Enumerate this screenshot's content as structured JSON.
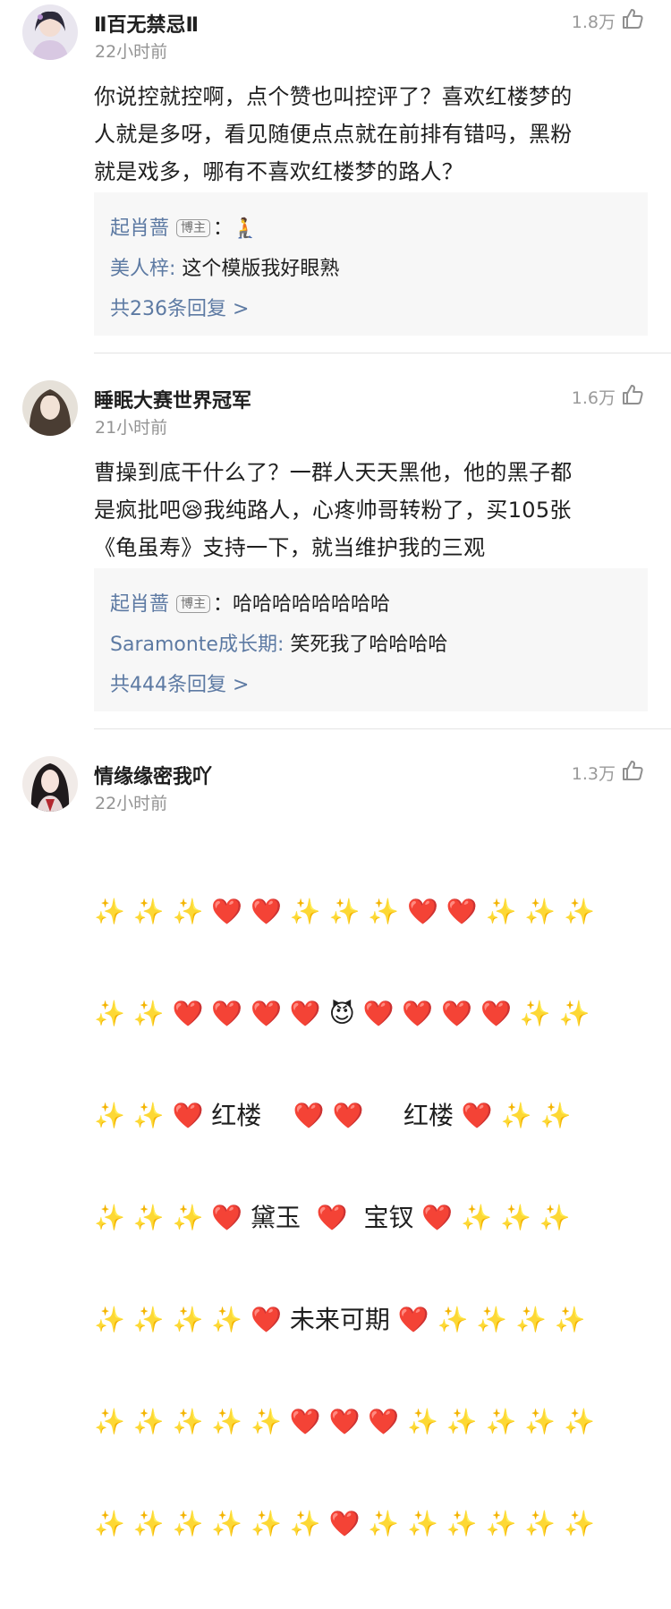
{
  "comments": [
    {
      "username": "Ⅱ百无禁忌Ⅱ",
      "time": "22小时前",
      "likes": "1.8万",
      "text": "你说控就控啊，点个赞也叫控评了？喜欢红楼梦的\n人就是多呀，看见随便点点就在前排有错吗，黑粉\n就是戏多，哪有不喜欢红楼梦的路人？",
      "replies": [
        {
          "name": "起肖蔷",
          "badge": "博主",
          "sep": "：",
          "content": "🧎"
        },
        {
          "name": "美人梓",
          "sep": ":",
          "content": " 这个模版我好眼熟"
        }
      ],
      "reply_total": "共236条回复 >"
    },
    {
      "username": "睡眠大赛世界冠军",
      "time": "21小时前",
      "likes": "1.6万",
      "text": "曹操到底干什么了？一群人天天黑他，他的黑子都\n是疯批吧😪我纯路人，心疼帅哥转粉了，买105张\n《龟虽寿》支持一下，就当维护我的三观",
      "replies": [
        {
          "name": "起肖蔷",
          "badge": "博主",
          "sep": "：",
          "content": "哈哈哈哈哈哈哈哈"
        },
        {
          "name": "Saramonte成长期",
          "sep": ":",
          "content": " 笑死我了哈哈哈哈"
        }
      ],
      "reply_total": "共444条回复 >"
    },
    {
      "username": "情缘缘密我吖",
      "time": "22小时前",
      "likes": "1.3万",
      "art_lines": [
        "✨ ✨ ✨ ❤️ ❤️ ✨ ✨ ✨ ❤️ ❤️ ✨ ✨ ✨",
        "✨ ✨ ❤️ ❤️ ❤️ ❤️ 😈 ❤️ ❤️ ❤️ ❤️ ✨ ✨",
        "✨ ✨ ❤️ 红楼    ❤️ ❤️     红楼 ❤️ ✨ ✨",
        "✨ ✨ ✨ ❤️ 黛玉  ❤️  宝钗 ❤️ ✨ ✨ ✨",
        "✨ ✨ ✨ ✨ ❤️ 未来可期 ❤️ ✨ ✨ ✨ ✨",
        "✨ ✨ ✨ ✨ ✨ ❤️ ❤️ ❤️ ✨ ✨ ✨ ✨ ✨",
        "✨ ✨ ✨ ✨ ✨ ✨ ❤️ ✨ ✨ ✨ ✨ ✨ ✨"
      ]
    }
  ],
  "colors": {
    "link": "#5d7aa3",
    "meta": "#939393",
    "reply_bg": "#f7f7f7"
  },
  "icons": [
    "avatar-1",
    "avatar-2",
    "avatar-3",
    "thumbs-up-icon"
  ]
}
